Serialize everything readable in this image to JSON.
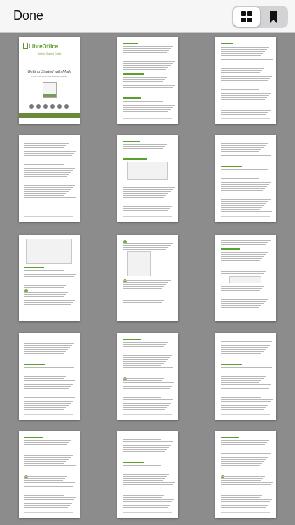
{
  "toolbar": {
    "done_label": "Done",
    "view_mode": "grid",
    "grid_icon": "grid-icon",
    "bookmark_icon": "bookmark-icon"
  },
  "cover": {
    "logo_text": "LibreOffice",
    "subtitle": "Getting Started Guide",
    "title": "Getting Started with Math",
    "subtitle2": "LibreOffice's Formula (Equation) Editor"
  },
  "colors": {
    "background": "#8c8c8c",
    "toolbar": "#f6f6f6",
    "accent": "#5aa02c"
  },
  "pages": [
    {
      "kind": "cover"
    },
    {
      "kind": "copyright"
    },
    {
      "kind": "contents"
    },
    {
      "kind": "contents2"
    },
    {
      "kind": "figure"
    },
    {
      "kind": "text"
    },
    {
      "kind": "figure2"
    },
    {
      "kind": "menu"
    },
    {
      "kind": "table"
    },
    {
      "kind": "text"
    },
    {
      "kind": "text"
    },
    {
      "kind": "text"
    },
    {
      "kind": "text"
    },
    {
      "kind": "text"
    },
    {
      "kind": "text"
    }
  ]
}
